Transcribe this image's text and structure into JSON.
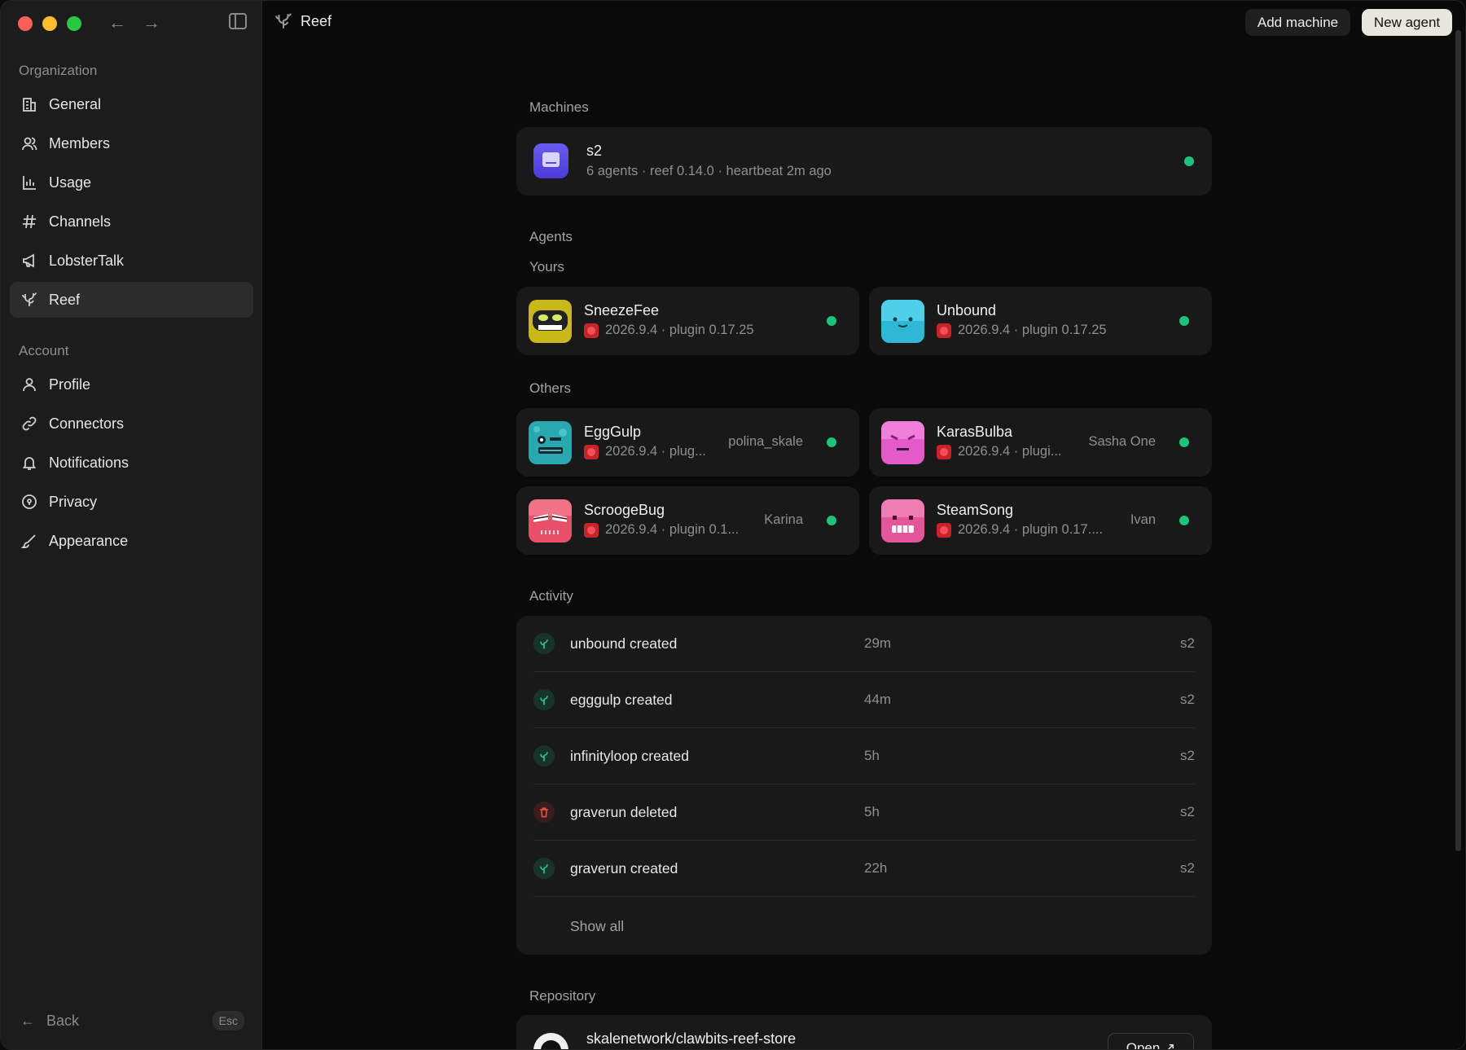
{
  "window": {
    "title": "Reef"
  },
  "toolbar": {
    "add_machine": "Add machine",
    "new_agent": "New agent"
  },
  "sidebar": {
    "org_label": "Organization",
    "account_label": "Account",
    "org_items": [
      {
        "label": "General",
        "icon": "building-icon"
      },
      {
        "label": "Members",
        "icon": "users-icon"
      },
      {
        "label": "Usage",
        "icon": "bar-chart-icon"
      },
      {
        "label": "Channels",
        "icon": "hash-icon"
      },
      {
        "label": "LobsterTalk",
        "icon": "megaphone-icon"
      },
      {
        "label": "Reef",
        "icon": "coral-icon",
        "active": true
      }
    ],
    "account_items": [
      {
        "label": "Profile",
        "icon": "user-icon"
      },
      {
        "label": "Connectors",
        "icon": "link-icon"
      },
      {
        "label": "Notifications",
        "icon": "bell-icon"
      },
      {
        "label": "Privacy",
        "icon": "shield-icon"
      },
      {
        "label": "Appearance",
        "icon": "brush-icon"
      }
    ],
    "back_label": "Back",
    "esc_label": "Esc"
  },
  "machines": {
    "heading": "Machines",
    "items": [
      {
        "name": "s2",
        "meta": "6 agents · reef 0.14.0 · heartbeat 2m ago",
        "status": "online"
      }
    ]
  },
  "agents": {
    "heading": "Agents",
    "yours_label": "Yours",
    "others_label": "Others",
    "yours": [
      {
        "name": "SneezeFee",
        "meta": "2026.9.4 · plugin 0.17.25",
        "owner": "",
        "status": "online"
      },
      {
        "name": "Unbound",
        "meta": "2026.9.4 · plugin 0.17.25",
        "owner": "",
        "status": "online"
      }
    ],
    "others": [
      {
        "name": "EggGulp",
        "meta": "2026.9.4 · plug...",
        "owner": "polina_skale",
        "status": "online"
      },
      {
        "name": "KarasBulba",
        "meta": "2026.9.4 · plugi...",
        "owner": "Sasha One",
        "status": "online"
      },
      {
        "name": "ScroogeBug",
        "meta": "2026.9.4 · plugin 0.1...",
        "owner": "Karina",
        "status": "online"
      },
      {
        "name": "SteamSong",
        "meta": "2026.9.4 · plugin 0.17....",
        "owner": "Ivan",
        "status": "online"
      }
    ]
  },
  "activity": {
    "heading": "Activity",
    "rows": [
      {
        "text": "unbound created",
        "time": "29m",
        "machine": "s2",
        "kind": "created"
      },
      {
        "text": "egggulp created",
        "time": "44m",
        "machine": "s2",
        "kind": "created"
      },
      {
        "text": "infinityloop created",
        "time": "5h",
        "machine": "s2",
        "kind": "created"
      },
      {
        "text": "graverun deleted",
        "time": "5h",
        "machine": "s2",
        "kind": "deleted"
      },
      {
        "text": "graverun created",
        "time": "22h",
        "machine": "s2",
        "kind": "created"
      }
    ],
    "show_all": "Show all"
  },
  "repository": {
    "heading": "Repository",
    "name": "skalenetwork/clawbits-reef-store",
    "open_label": "Open ↗"
  },
  "colors": {
    "status_online": "#1ec27a",
    "accent_button": "#e9e6dd"
  }
}
